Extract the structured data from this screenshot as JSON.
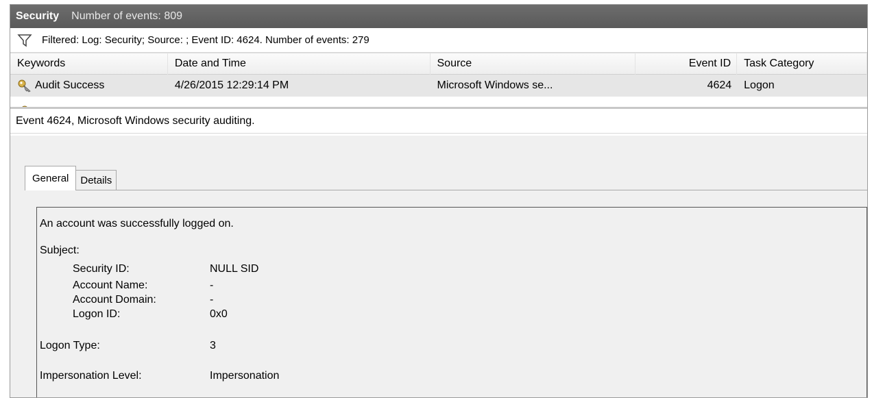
{
  "title_bar": {
    "log": "Security",
    "count_text": "Number of events: 809"
  },
  "filter": {
    "text": "Filtered: Log: Security; Source: ; Event ID: 4624. Number of events: 279"
  },
  "list": {
    "columns": [
      "Keywords",
      "Date and Time",
      "Source",
      "Event ID",
      "Task Category"
    ],
    "rows": [
      {
        "keywords": "Audit Success",
        "date_time": "4/26/2015 12:29:14 PM",
        "source": "Microsoft Windows se...",
        "event_id": "4624",
        "task_category": "Logon"
      }
    ]
  },
  "detail": {
    "title": "Event 4624, Microsoft Windows security auditing.",
    "tabs": [
      "General",
      "Details"
    ],
    "message": "An account was successfully logged on.",
    "subject_label": "Subject:",
    "fields": [
      {
        "label": "Security ID:",
        "value": "NULL SID"
      },
      {
        "label": "Account Name:",
        "value": "-"
      },
      {
        "label": "Account Domain:",
        "value": "-"
      },
      {
        "label": "Logon ID:",
        "value": "0x0"
      }
    ],
    "logon_type": {
      "label": "Logon Type:",
      "value": "3"
    },
    "impersonation": {
      "label": "Impersonation Level:",
      "value": "Impersonation"
    }
  },
  "icons": {
    "filter": "funnel-icon",
    "keyword": "key-icon"
  },
  "colors": {
    "title_bar": "#5f5f5f",
    "detail_background": "#f0f0f0",
    "selected_row": "#e6e6e6"
  }
}
